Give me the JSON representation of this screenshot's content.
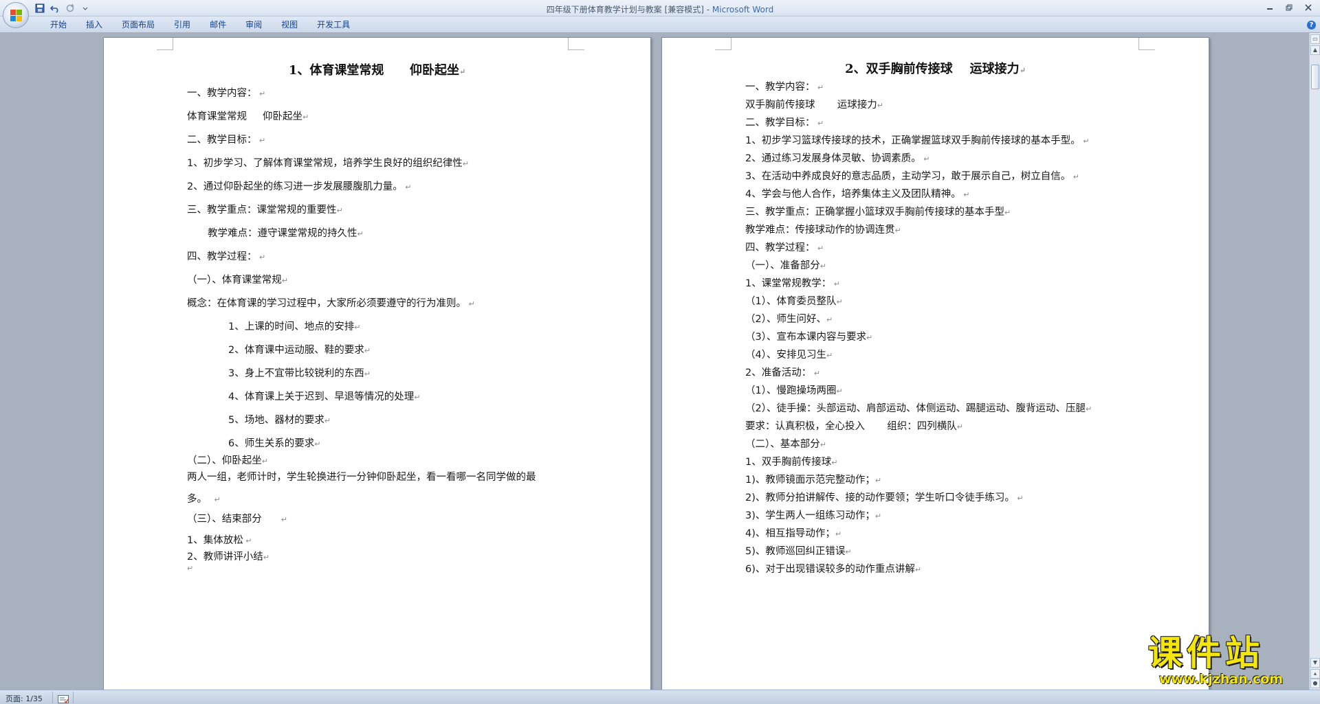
{
  "window": {
    "title": "四年级下册体育教学计划与教案 [兼容模式] - ",
    "app_name": "Microsoft Word"
  },
  "ribbon": {
    "tabs": [
      "开始",
      "插入",
      "页面布局",
      "引用",
      "邮件",
      "审阅",
      "视图",
      "开发工具"
    ]
  },
  "status": {
    "page_label": "页面: 1/35"
  },
  "watermark": {
    "cn": "课件站",
    "url": "www.kjzhan.com"
  },
  "left_page": {
    "title": "1、体育课堂常规      仰卧起坐",
    "lines": [
      "一、教学内容：",
      "体育课堂常规     仰卧起坐",
      "二、教学目标：",
      "1、初步学习、了解体育课堂常规，培养学生良好的组织纪律性",
      "2、通过仰卧起坐的练习进一步发展腰腹肌力量。",
      "三、教学重点：课堂常规的重要性",
      "教学难点：遵守课堂常规的持久性",
      "四、教学过程：",
      "（一）、体育课堂常规",
      "概念：在体育课的学习过程中，大家所必须要遵守的行为准则。",
      "1、上课的时间、地点的安排",
      "2、体育课中运动服、鞋的要求",
      "3、身上不宜带比较锐利的东西",
      "4、体育课上关于迟到、早退等情况的处理",
      "5、场地、器材的要求",
      "6、师生关系的要求",
      "（二）、仰卧起坐",
      "两人一组，老师计时，学生轮换进行一分钟仰卧起坐，看一看哪一名同学做的最",
      "多。",
      "（三）、结束部分",
      "1、集体放松",
      "2、教师讲评小结",
      ""
    ]
  },
  "right_page": {
    "title": "2、双手胸前传接球    运球接力",
    "lines": [
      "一、教学内容：",
      "双手胸前传接球       运球接力",
      "二、教学目标：",
      "1、初步学习篮球传接球的技术，正确掌握篮球双手胸前传接球的基本手型。",
      "2、通过练习发展身体灵敏、协调素质。",
      "3、在活动中养成良好的意志品质，主动学习，敢于展示自己，树立自信。",
      "4、学会与他人合作，培养集体主义及团队精神。",
      "三、教学重点：正确掌握小篮球双手胸前传接球的基本手型",
      "教学难点：传接球动作的协调连贯",
      "四、教学过程：",
      "（一）、准备部分",
      "1、课堂常规教学：",
      "（1）、体育委员整队",
      "（2）、师生问好、",
      "（3）、宣布本课内容与要求",
      "（4）、安排见习生",
      "2、准备活动：",
      "（1）、慢跑操场两圈",
      "（2）、徒手操：头部运动、肩部运动、体侧运动、踢腿运动、腹背运动、压腿",
      "要求：认真积极，全心投入       组织：四列横队",
      "（二）、基本部分",
      "1、双手胸前传接球",
      "1)、教师镜面示范完整动作；",
      "2)、教师分拍讲解传、接的动作要领；学生听口令徒手练习。",
      "3)、学生两人一组练习动作；",
      "4)、相互指导动作；",
      "5)、教师巡回纠正错误",
      "6)、对于出现错误较多的动作重点讲解"
    ]
  }
}
